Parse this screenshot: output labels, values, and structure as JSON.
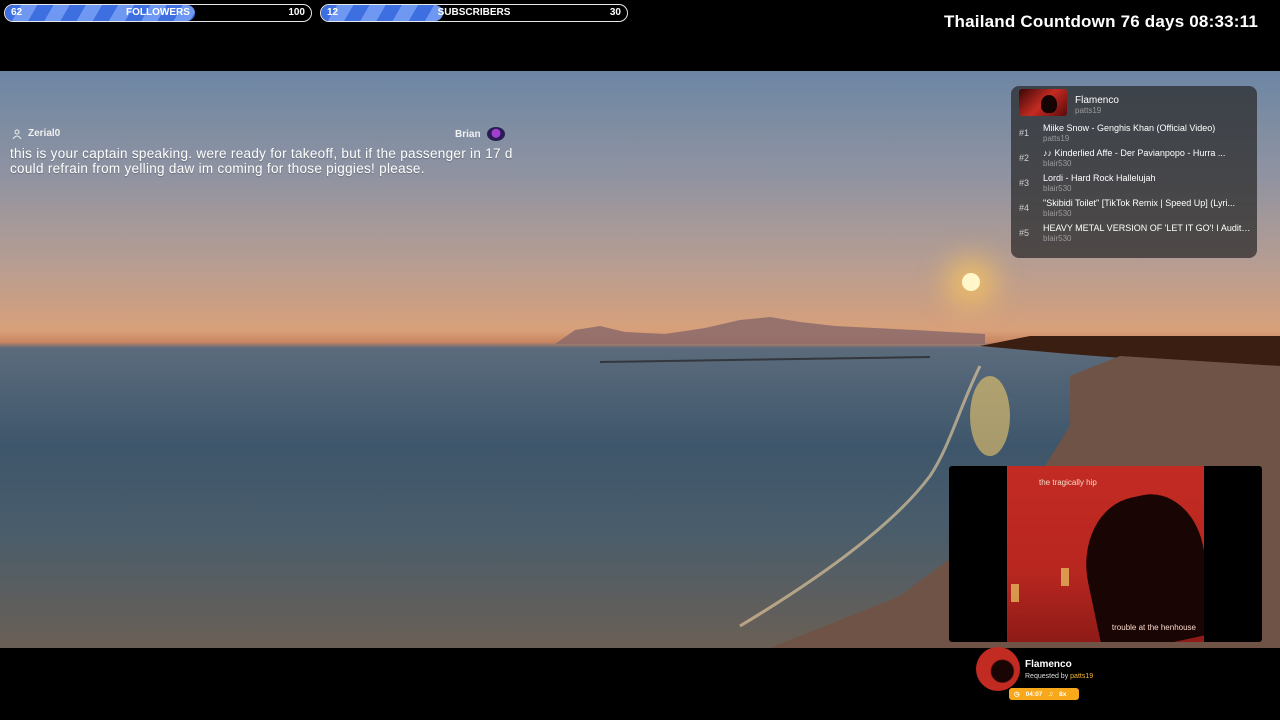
{
  "goals": [
    {
      "current": "62",
      "label": "FOLLOWERS",
      "max": "100",
      "progress": 0.62
    },
    {
      "current": "12",
      "label": "SUBSCRIBERS",
      "max": "30",
      "progress": 0.4
    }
  ],
  "countdown": "Thailand Countdown 76 days 08:33:11",
  "chat": {
    "username": "Zerial0",
    "reply_to": "Brian",
    "message": "this is your captain speaking. were ready for takeoff, but if the passenger in 17 d could refrain from yelling daw im coming for those piggies! please."
  },
  "queue": {
    "now": {
      "title": "Flamenco",
      "user": "patts19"
    },
    "items": [
      {
        "num": "#1",
        "title": "Miike Snow - Genghis Khan (Official Video)",
        "user": "patts19"
      },
      {
        "num": "#2",
        "title": "♪♪ Kinderlied Affe - Der Pavianpopo - Hurra ...",
        "user": "blair530"
      },
      {
        "num": "#3",
        "title": "Lordi - Hard Rock Hallelujah",
        "user": "blair530"
      },
      {
        "num": "#4",
        "title": "\"Skibidi Toilet\" [TikTok Remix | Speed Up] (Lyri...",
        "user": "blair530"
      },
      {
        "num": "#5",
        "title": "HEAVY METAL VERSION OF 'LET IT GO'! I Auditio...",
        "user": "blair530"
      }
    ]
  },
  "video": {
    "band": "the tragically hip",
    "song": "trouble at the henhouse"
  },
  "now_playing": {
    "title": "Flamenco",
    "requested_prefix": "Requested by",
    "requested_by": "patts19",
    "duration": "04:07",
    "count": "8x"
  }
}
